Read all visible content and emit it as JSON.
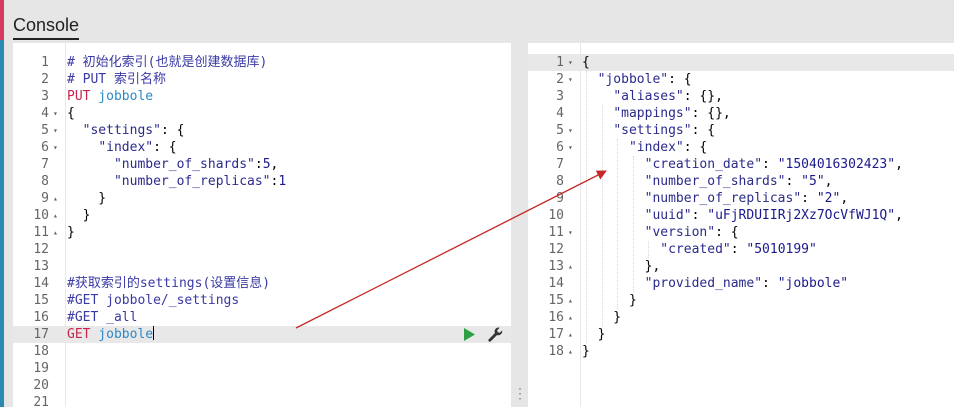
{
  "app": {
    "tab_label": "Console",
    "accent_colors": {
      "top": "#d63b5f",
      "bottom": "#2c8ab1"
    },
    "run_icon": "play-icon",
    "settings_icon": "wrench-icon",
    "fold_icons": {
      "open": "triangle-down-icon",
      "close": "triangle-up-icon"
    }
  },
  "request_editor": {
    "lines": [
      {
        "n": "1",
        "fold": "",
        "tokens": [
          {
            "t": "# 初始化索引(也就是创建数据库)",
            "c": "comment"
          }
        ]
      },
      {
        "n": "2",
        "fold": "",
        "tokens": [
          {
            "t": "# PUT 索引名称",
            "c": "comment"
          }
        ]
      },
      {
        "n": "3",
        "fold": "",
        "tokens": [
          {
            "t": "PUT",
            "c": "method"
          },
          {
            "t": " jobbole",
            "c": "url"
          }
        ]
      },
      {
        "n": "4",
        "fold": "▾",
        "tokens": [
          {
            "t": "{",
            "c": "punc"
          }
        ]
      },
      {
        "n": "5",
        "fold": "▾",
        "tokens": [
          {
            "t": "  ",
            "c": "punc"
          },
          {
            "t": "\"settings\"",
            "c": "key"
          },
          {
            "t": ": {",
            "c": "punc"
          }
        ]
      },
      {
        "n": "6",
        "fold": "▾",
        "tokens": [
          {
            "t": "    ",
            "c": "punc"
          },
          {
            "t": "\"index\"",
            "c": "key"
          },
          {
            "t": ": {",
            "c": "punc"
          }
        ]
      },
      {
        "n": "7",
        "fold": "",
        "tokens": [
          {
            "t": "      ",
            "c": "punc"
          },
          {
            "t": "\"number_of_shards\"",
            "c": "key"
          },
          {
            "t": ":",
            "c": "punc"
          },
          {
            "t": "5",
            "c": "num"
          },
          {
            "t": ",",
            "c": "punc"
          }
        ]
      },
      {
        "n": "8",
        "fold": "",
        "tokens": [
          {
            "t": "      ",
            "c": "punc"
          },
          {
            "t": "\"number_of_replicas\"",
            "c": "key"
          },
          {
            "t": ":",
            "c": "punc"
          },
          {
            "t": "1",
            "c": "num"
          }
        ]
      },
      {
        "n": "9",
        "fold": "▴",
        "tokens": [
          {
            "t": "    }",
            "c": "punc"
          }
        ]
      },
      {
        "n": "10",
        "fold": "▴",
        "tokens": [
          {
            "t": "  }",
            "c": "punc"
          }
        ]
      },
      {
        "n": "11",
        "fold": "▴",
        "tokens": [
          {
            "t": "}",
            "c": "punc"
          }
        ]
      },
      {
        "n": "12",
        "fold": "",
        "tokens": []
      },
      {
        "n": "13",
        "fold": "",
        "tokens": []
      },
      {
        "n": "14",
        "fold": "",
        "tokens": [
          {
            "t": "#获取索引的settings(设置信息)",
            "c": "comment"
          }
        ]
      },
      {
        "n": "15",
        "fold": "",
        "tokens": [
          {
            "t": "#GET jobbole/_settings",
            "c": "comment"
          }
        ]
      },
      {
        "n": "16",
        "fold": "",
        "tokens": [
          {
            "t": "#GET _all",
            "c": "comment"
          }
        ]
      },
      {
        "n": "17",
        "fold": "",
        "active": true,
        "tokens": [
          {
            "t": "GET",
            "c": "method"
          },
          {
            "t": " jobbole",
            "c": "url"
          }
        ]
      },
      {
        "n": "18",
        "fold": "",
        "tokens": []
      },
      {
        "n": "19",
        "fold": "",
        "tokens": []
      },
      {
        "n": "20",
        "fold": "",
        "tokens": []
      },
      {
        "n": "21",
        "fold": "",
        "tokens": []
      }
    ]
  },
  "response_viewer": {
    "lines": [
      {
        "n": "1",
        "fold": "▾",
        "active": true,
        "tokens": [
          {
            "t": "{",
            "c": "punc"
          }
        ]
      },
      {
        "n": "2",
        "fold": "▾",
        "tokens": [
          {
            "t": "  ",
            "c": "punc"
          },
          {
            "t": "\"jobbole\"",
            "c": "key"
          },
          {
            "t": ": {",
            "c": "punc"
          }
        ]
      },
      {
        "n": "3",
        "fold": "",
        "tokens": [
          {
            "t": "    ",
            "c": "punc"
          },
          {
            "t": "\"aliases\"",
            "c": "key"
          },
          {
            "t": ": {},",
            "c": "punc"
          }
        ]
      },
      {
        "n": "4",
        "fold": "",
        "tokens": [
          {
            "t": "    ",
            "c": "punc"
          },
          {
            "t": "\"mappings\"",
            "c": "key"
          },
          {
            "t": ": {},",
            "c": "punc"
          }
        ]
      },
      {
        "n": "5",
        "fold": "▾",
        "tokens": [
          {
            "t": "    ",
            "c": "punc"
          },
          {
            "t": "\"settings\"",
            "c": "key"
          },
          {
            "t": ": {",
            "c": "punc"
          }
        ]
      },
      {
        "n": "6",
        "fold": "▾",
        "tokens": [
          {
            "t": "      ",
            "c": "punc"
          },
          {
            "t": "\"index\"",
            "c": "key"
          },
          {
            "t": ": {",
            "c": "punc"
          }
        ]
      },
      {
        "n": "7",
        "fold": "",
        "tokens": [
          {
            "t": "        ",
            "c": "punc"
          },
          {
            "t": "\"creation_date\"",
            "c": "key"
          },
          {
            "t": ": ",
            "c": "punc"
          },
          {
            "t": "\"1504016302423\"",
            "c": "str"
          },
          {
            "t": ",",
            "c": "punc"
          }
        ]
      },
      {
        "n": "8",
        "fold": "",
        "tokens": [
          {
            "t": "        ",
            "c": "punc"
          },
          {
            "t": "\"number_of_shards\"",
            "c": "key"
          },
          {
            "t": ": ",
            "c": "punc"
          },
          {
            "t": "\"5\"",
            "c": "str"
          },
          {
            "t": ",",
            "c": "punc"
          }
        ]
      },
      {
        "n": "9",
        "fold": "",
        "tokens": [
          {
            "t": "        ",
            "c": "punc"
          },
          {
            "t": "\"number_of_replicas\"",
            "c": "key"
          },
          {
            "t": ": ",
            "c": "punc"
          },
          {
            "t": "\"2\"",
            "c": "str"
          },
          {
            "t": ",",
            "c": "punc"
          }
        ]
      },
      {
        "n": "10",
        "fold": "",
        "tokens": [
          {
            "t": "        ",
            "c": "punc"
          },
          {
            "t": "\"uuid\"",
            "c": "key"
          },
          {
            "t": ": ",
            "c": "punc"
          },
          {
            "t": "\"uFjRDUIIRj2Xz7OcVfWJ1Q\"",
            "c": "str"
          },
          {
            "t": ",",
            "c": "punc"
          }
        ]
      },
      {
        "n": "11",
        "fold": "▾",
        "tokens": [
          {
            "t": "        ",
            "c": "punc"
          },
          {
            "t": "\"version\"",
            "c": "key"
          },
          {
            "t": ": {",
            "c": "punc"
          }
        ]
      },
      {
        "n": "12",
        "fold": "",
        "tokens": [
          {
            "t": "          ",
            "c": "punc"
          },
          {
            "t": "\"created\"",
            "c": "key"
          },
          {
            "t": ": ",
            "c": "punc"
          },
          {
            "t": "\"5010199\"",
            "c": "str"
          }
        ]
      },
      {
        "n": "13",
        "fold": "▴",
        "tokens": [
          {
            "t": "        },",
            "c": "punc"
          }
        ]
      },
      {
        "n": "14",
        "fold": "",
        "tokens": [
          {
            "t": "        ",
            "c": "punc"
          },
          {
            "t": "\"provided_name\"",
            "c": "key"
          },
          {
            "t": ": ",
            "c": "punc"
          },
          {
            "t": "\"jobbole\"",
            "c": "str"
          }
        ]
      },
      {
        "n": "15",
        "fold": "▴",
        "tokens": [
          {
            "t": "      }",
            "c": "punc"
          }
        ]
      },
      {
        "n": "16",
        "fold": "▴",
        "tokens": [
          {
            "t": "    }",
            "c": "punc"
          }
        ]
      },
      {
        "n": "17",
        "fold": "▴",
        "tokens": [
          {
            "t": "  }",
            "c": "punc"
          }
        ]
      },
      {
        "n": "18",
        "fold": "▴",
        "tokens": [
          {
            "t": "}",
            "c": "punc"
          }
        ]
      }
    ]
  }
}
